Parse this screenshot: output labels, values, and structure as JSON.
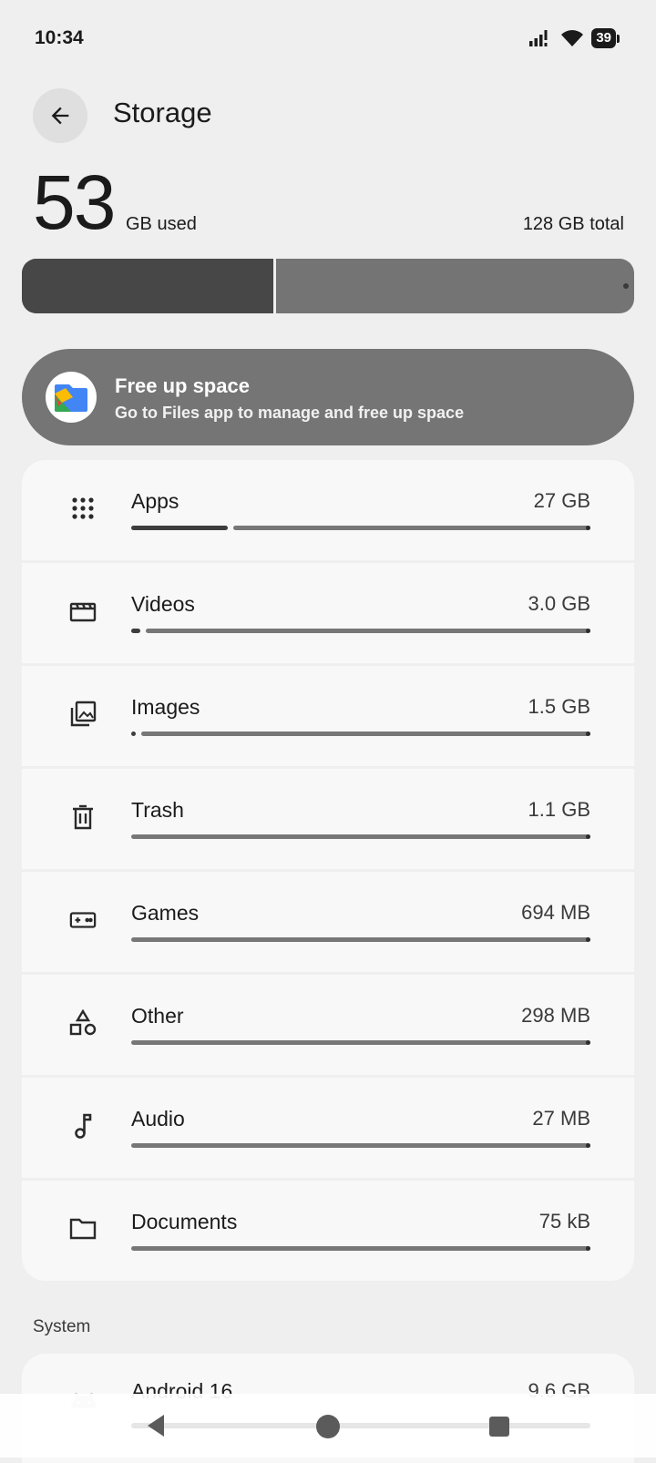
{
  "status_bar": {
    "time": "10:34",
    "battery": "39"
  },
  "header": {
    "title": "Storage"
  },
  "summary": {
    "used_value": "53",
    "used_unit": "GB used",
    "total": "128 GB total",
    "used_fraction": 0.41
  },
  "free_up": {
    "title": "Free up space",
    "subtitle": "Go to Files app to manage and free up space"
  },
  "categories": [
    {
      "label": "Apps",
      "size": "27 GB",
      "icon": "apps-grid-icon",
      "fraction": 0.21
    },
    {
      "label": "Videos",
      "size": "3.0 GB",
      "icon": "video-clapper-icon",
      "fraction": 0.02
    },
    {
      "label": "Images",
      "size": "1.5 GB",
      "icon": "image-library-icon",
      "fraction": 0.01
    },
    {
      "label": "Trash",
      "size": "1.1 GB",
      "icon": "trash-icon",
      "fraction": 0.0
    },
    {
      "label": "Games",
      "size": "694 MB",
      "icon": "gamepad-icon",
      "fraction": 0.0
    },
    {
      "label": "Other",
      "size": "298 MB",
      "icon": "shapes-icon",
      "fraction": 0.0
    },
    {
      "label": "Audio",
      "size": "27 MB",
      "icon": "music-note-icon",
      "fraction": 0.0
    },
    {
      "label": "Documents",
      "size": "75 kB",
      "icon": "folder-icon",
      "fraction": 0.0
    }
  ],
  "system_section": {
    "title": "System",
    "items": [
      {
        "label": "Android 16",
        "size": "9.6 GB",
        "icon": "android-icon"
      }
    ]
  },
  "colors": {
    "accent_dark": "#3d3d3d",
    "track": "#777777",
    "card": "#f8f8f8",
    "background": "#efefef"
  }
}
